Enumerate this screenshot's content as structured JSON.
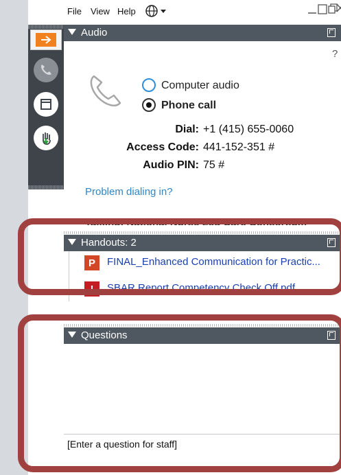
{
  "menu": {
    "file": "File",
    "view": "View",
    "help": "Help"
  },
  "toolbar": {
    "items": [
      "collapse-arrow-icon",
      "phone-icon",
      "panel-icon",
      "raise-hand-icon"
    ],
    "accent": "#f0811e"
  },
  "audio": {
    "title": "Audio",
    "help_glyph": "?",
    "options": [
      {
        "label": "Computer audio",
        "selected": false
      },
      {
        "label": "Phone call",
        "selected": true
      }
    ],
    "dial_label": "Dial:",
    "dial_value": "+1 (415) 655-0060",
    "access_label": "Access Code:",
    "access_value": "441-152-351 #",
    "pin_label": "Audio PIN:",
    "pin_value": "75 #",
    "problem_link": "Problem dialing in?",
    "talking_text": "Talking: National Nurse Led Care Consortium"
  },
  "handouts": {
    "title": "Handouts: 2",
    "files": [
      {
        "name": "FINAL_Enhanced Communication for Practic...",
        "type_letter": "P",
        "color": "#d24726"
      },
      {
        "name": "SBAR Report Competency Check Off.pdf",
        "type_letter": "!",
        "color": "#c41e24"
      }
    ]
  },
  "questions": {
    "title": "Questions",
    "placeholder": "[Enter a question for staff]"
  },
  "colors": {
    "header_bg": "#4f5760",
    "highlight": "#a0413f",
    "link": "#2e86c9"
  }
}
